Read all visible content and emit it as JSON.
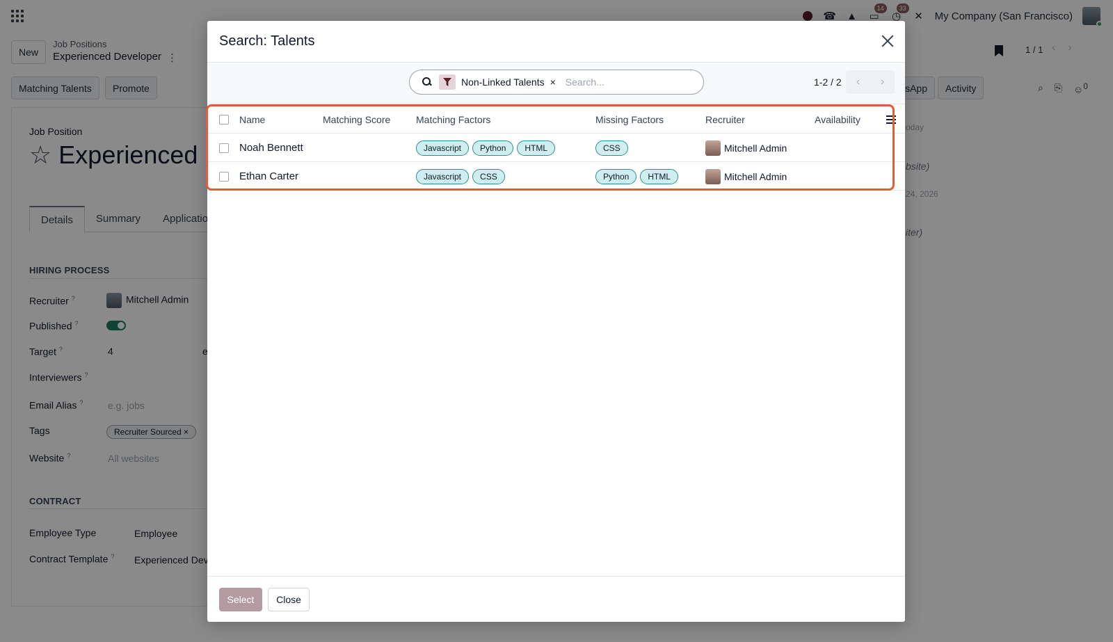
{
  "navbar": {
    "company": "My Company (San Francisco)",
    "messages_badge": "14",
    "activities_badge": "33"
  },
  "control_panel": {
    "new_label": "New",
    "breadcrumb_parent": "Job Positions",
    "breadcrumb_current": "Experienced Developer",
    "pager": "1 / 1",
    "buttons": [
      "Matching Talents",
      "Promote",
      "sApp",
      "Activity"
    ],
    "followers_count": "0"
  },
  "form": {
    "label_top": "Job Position",
    "title": "Experienced D",
    "tabs": [
      "Details",
      "Summary",
      "Application"
    ],
    "hiring_section": "HIRING PROCESS",
    "contract_section": "CONTRACT",
    "fields": {
      "recruiter_label": "Recruiter",
      "recruiter_value": "Mitchell Admin",
      "published_label": "Published",
      "target_label": "Target",
      "target_value": "4",
      "target_suffix": "e",
      "interviewers_label": "Interviewers",
      "email_alias_label": "Email Alias",
      "email_alias_placeholder": "e.g. jobs",
      "tags_label": "Tags",
      "tag_value": "Recruiter Sourced",
      "website_label": "Website",
      "website_placeholder": "All websites",
      "employee_type_label": "Employee Type",
      "employee_type_value": "Employee",
      "contract_template_label": "Contract Template",
      "contract_template_value": "Experienced Dev"
    },
    "right_fragments": [
      "oday",
      "bsite)",
      "24, 2026",
      "iter)"
    ]
  },
  "modal": {
    "title": "Search: Talents",
    "search": {
      "facet": "Non-Linked Talents",
      "facet_remove": "×",
      "placeholder": "Search..."
    },
    "pager": "1-2 / 2",
    "columns": [
      "Name",
      "Matching Score",
      "Matching Factors",
      "Missing Factors",
      "Recruiter",
      "Availability"
    ],
    "rows": [
      {
        "name": "Noah Bennett",
        "matching_score": "",
        "matching_factors": [
          "Javascript",
          "Python",
          "HTML"
        ],
        "missing_factors": [
          "CSS"
        ],
        "recruiter": "Mitchell Admin",
        "availability": ""
      },
      {
        "name": "Ethan Carter",
        "matching_score": "",
        "matching_factors": [
          "Javascript",
          "CSS"
        ],
        "missing_factors": [
          "Python",
          "HTML"
        ],
        "recruiter": "Mitchell Admin",
        "availability": ""
      }
    ],
    "footer": {
      "select_label": "Select",
      "close_label": "Close"
    }
  },
  "colors": {
    "highlight": "#e25c3a",
    "pill_bg": "#cfeef0",
    "pill_border": "#2a8f95",
    "primary_disabled": "#b49ba2"
  }
}
